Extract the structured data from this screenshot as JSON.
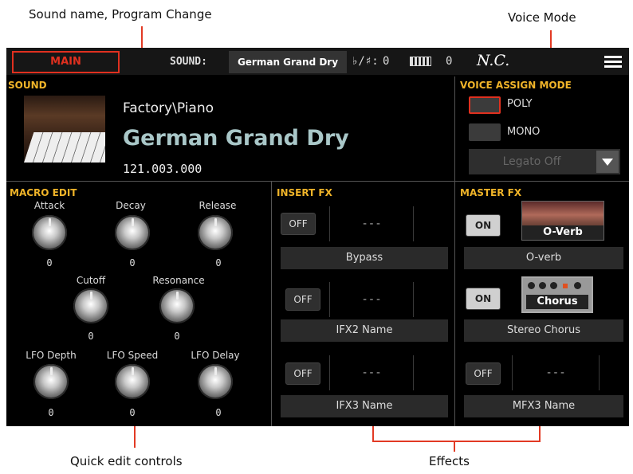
{
  "callouts": {
    "sound_name": "Sound name, Program Change",
    "voice_mode": "Voice Mode",
    "quick_edit": "Quick edit controls",
    "effects": "Effects"
  },
  "topbar": {
    "main_tab": "MAIN",
    "sound_label": "SOUND:",
    "sound_name": "German Grand Dry",
    "transpose_label": "♭/♯:",
    "transpose_value": "0",
    "octave_value": "0",
    "chord": "N.C."
  },
  "sound": {
    "section_title": "SOUND",
    "path": "Factory\\Piano",
    "name": "German Grand Dry",
    "program_change": "121.003.000"
  },
  "voice_assign": {
    "section_title": "VOICE ASSIGN MODE",
    "poly_label": "POLY",
    "mono_label": "MONO",
    "legato": "Legato Off",
    "selected": "POLY"
  },
  "macro": {
    "section_title": "MACRO EDIT",
    "knobs": [
      {
        "label": "Attack",
        "value": "0"
      },
      {
        "label": "Decay",
        "value": "0"
      },
      {
        "label": "Release",
        "value": "0"
      },
      {
        "label": "Cutoff",
        "value": "0"
      },
      {
        "label": "Resonance",
        "value": "0"
      },
      {
        "label": "LFO Depth",
        "value": "0"
      },
      {
        "label": "LFO Speed",
        "value": "0"
      },
      {
        "label": "LFO Delay",
        "value": "0"
      }
    ]
  },
  "insert_fx": {
    "section_title": "INSERT FX",
    "slots": [
      {
        "state": "OFF",
        "slot_text": "---",
        "name": "Bypass"
      },
      {
        "state": "OFF",
        "slot_text": "---",
        "name": "IFX2 Name"
      },
      {
        "state": "OFF",
        "slot_text": "---",
        "name": "IFX3 Name"
      }
    ]
  },
  "master_fx": {
    "section_title": "MASTER FX",
    "slots": [
      {
        "state": "ON",
        "image_label": "O-Verb",
        "name": "O-verb"
      },
      {
        "state": "ON",
        "image_label": "Chorus",
        "name": "Stereo Chorus"
      },
      {
        "state": "OFF",
        "slot_text": "---",
        "name": "MFX3 Name"
      }
    ]
  },
  "colors": {
    "accent_red": "#e0301f",
    "section_title": "#f0b429",
    "sound_name": "#a9c7c8"
  }
}
